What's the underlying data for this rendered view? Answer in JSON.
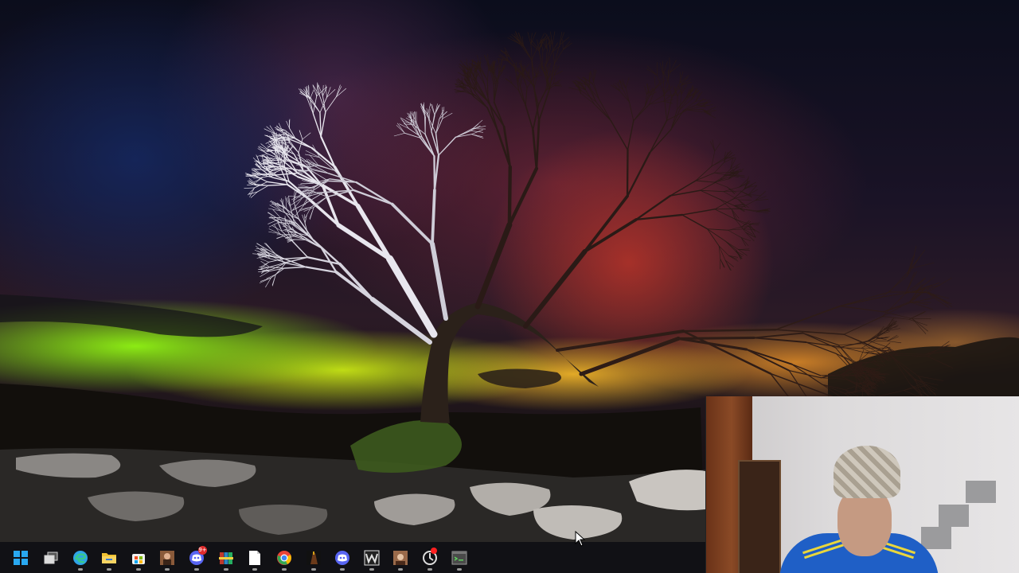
{
  "screen": {
    "wallpaper": "aurora-tree-night",
    "accent": "#0078d4"
  },
  "taskbar": {
    "items": [
      {
        "name": "start",
        "icon": "windows-logo-icon",
        "color": "#29a8f0"
      },
      {
        "name": "task-view",
        "icon": "task-view-icon",
        "color": "#cfcfcf"
      },
      {
        "name": "edge",
        "icon": "edge-icon",
        "color": "#2fa4e7"
      },
      {
        "name": "file-explorer",
        "icon": "folder-icon",
        "color": "#f1c232"
      },
      {
        "name": "microsoft-store",
        "icon": "store-icon",
        "color": "#f0f0f0"
      },
      {
        "name": "game-app-1",
        "icon": "game-character-icon",
        "color": "#8a5a3a"
      },
      {
        "name": "discord-notifications",
        "icon": "discord-icon",
        "color": "#5865f2",
        "badge": "9+"
      },
      {
        "name": "winrar",
        "icon": "archive-books-icon",
        "color": "#c0392b"
      },
      {
        "name": "document",
        "icon": "blank-document-icon",
        "color": "#ffffff"
      },
      {
        "name": "chrome",
        "icon": "chrome-icon",
        "color": "#ea4335"
      },
      {
        "name": "game-app-2",
        "icon": "warrior-icon",
        "color": "#6b3a1a"
      },
      {
        "name": "discord",
        "icon": "discord-icon",
        "color": "#5865f2"
      },
      {
        "name": "wps",
        "icon": "w-logo-icon",
        "color": "#e0e0e0"
      },
      {
        "name": "game-app-3",
        "icon": "portrait-icon",
        "color": "#9a6a4a"
      },
      {
        "name": "recorder",
        "icon": "record-icon",
        "color": "#ff2020"
      },
      {
        "name": "terminal-tool",
        "icon": "terminal-icon",
        "color": "#4a4a4a"
      }
    ]
  },
  "webcam": {
    "label": "webcam-overlay"
  }
}
